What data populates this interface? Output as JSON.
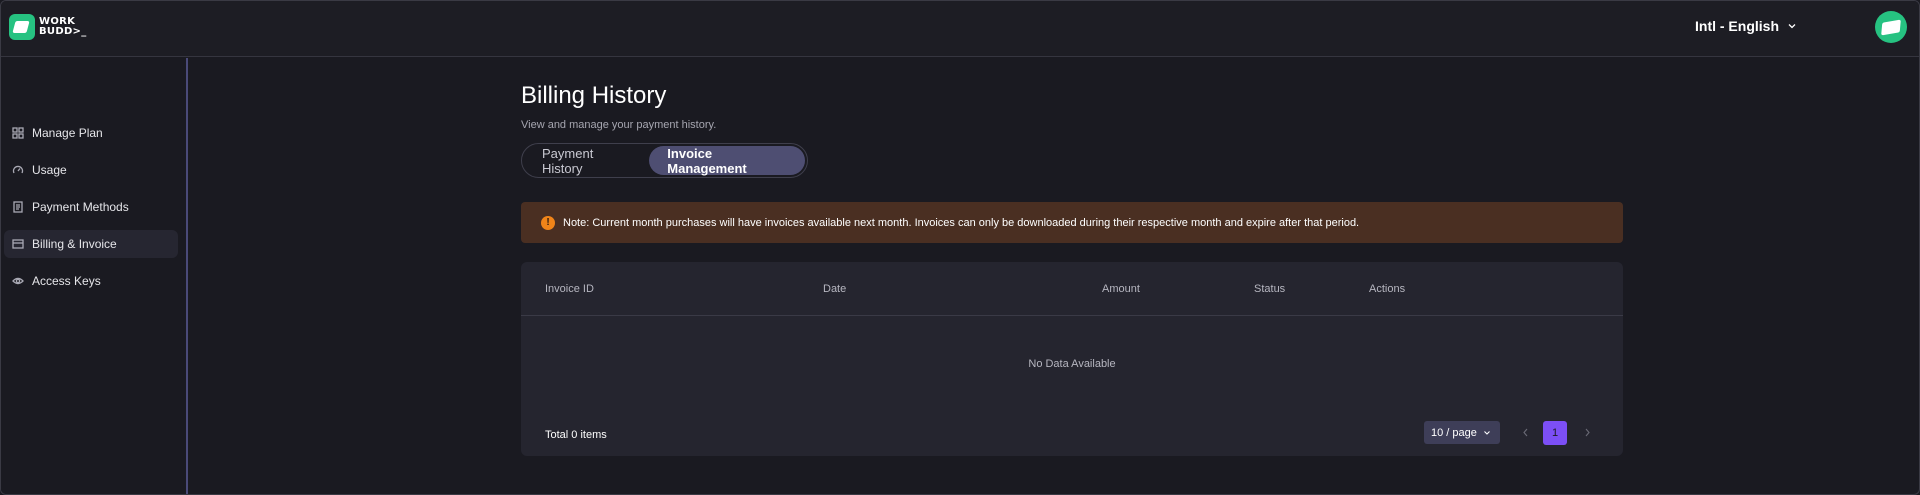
{
  "brand": {
    "logo_line1": "WORK",
    "logo_line2": "BUDD>_"
  },
  "header": {
    "language": "Intl - English"
  },
  "sidebar": {
    "items": [
      {
        "label": "Manage Plan",
        "icon": "grid-icon"
      },
      {
        "label": "Usage",
        "icon": "gauge-icon"
      },
      {
        "label": "Payment Methods",
        "icon": "document-icon"
      },
      {
        "label": "Billing & Invoice",
        "icon": "card-icon",
        "active": true
      },
      {
        "label": "Access Keys",
        "icon": "eye-icon"
      }
    ]
  },
  "main": {
    "title": "Billing History",
    "subtitle": "View and manage your payment history.",
    "tabs": [
      {
        "label": "Payment History",
        "active": false
      },
      {
        "label": "Invoice Management",
        "active": true
      }
    ],
    "note": "Note: Current month purchases will have invoices available next month. Invoices can only be downloaded during their respective month and expire after that period.",
    "table": {
      "columns": [
        "Invoice ID",
        "Date",
        "Amount",
        "Status",
        "Actions"
      ],
      "empty_text": "No Data Available",
      "total": "Total 0 items"
    },
    "pagination": {
      "page_size": "10 / page",
      "current_page": "1"
    }
  },
  "colors": {
    "accent": "#7c4ff6",
    "brand_green": "#26c281",
    "note_bg": "#4a2f22",
    "note_icon": "#f08419",
    "active_tab": "#4e4e72"
  }
}
